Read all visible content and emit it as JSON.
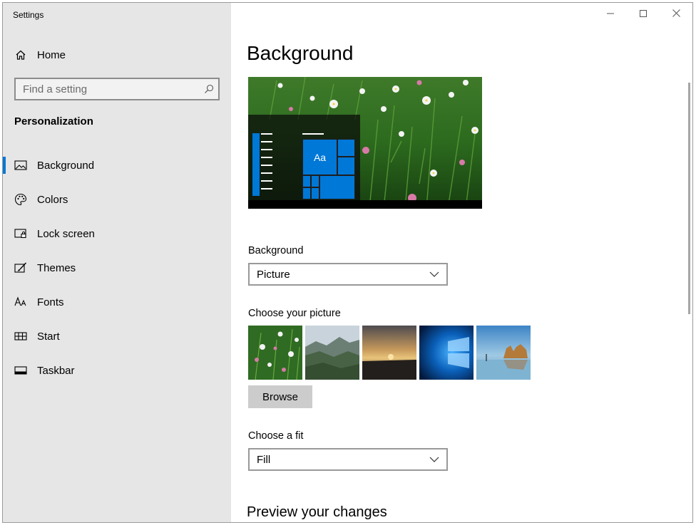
{
  "window": {
    "title": "Settings",
    "controls": [
      "minimize-icon",
      "maximize-icon",
      "close-icon"
    ]
  },
  "sidebar": {
    "home_label": "Home",
    "search": {
      "placeholder": "Find a setting"
    },
    "section_title": "Personalization",
    "items": [
      {
        "label": "Background",
        "icon": "picture-icon",
        "active": true
      },
      {
        "label": "Colors",
        "icon": "palette-icon",
        "active": false
      },
      {
        "label": "Lock screen",
        "icon": "lock-screen-icon",
        "active": false
      },
      {
        "label": "Themes",
        "icon": "themes-brush-icon",
        "active": false
      },
      {
        "label": "Fonts",
        "icon": "fonts-icon",
        "active": false
      },
      {
        "label": "Start",
        "icon": "start-grid-icon",
        "active": false
      },
      {
        "label": "Taskbar",
        "icon": "taskbar-icon",
        "active": false
      }
    ]
  },
  "main": {
    "title": "Background",
    "preview": {
      "tile_text": "Aa"
    },
    "background_label": "Background",
    "background_value": "Picture",
    "choose_picture_label": "Choose your picture",
    "pictures": [
      "wildflowers",
      "mountain-valley",
      "sunset-coast",
      "windows-logo",
      "beach-rocks"
    ],
    "browse_label": "Browse",
    "fit_label": "Choose a fit",
    "fit_value": "Fill",
    "preview_heading": "Preview your changes"
  },
  "colors": {
    "accent": "#0078d7",
    "sidebar_bg": "#e6e6e6",
    "button_bg": "#cccccc"
  }
}
